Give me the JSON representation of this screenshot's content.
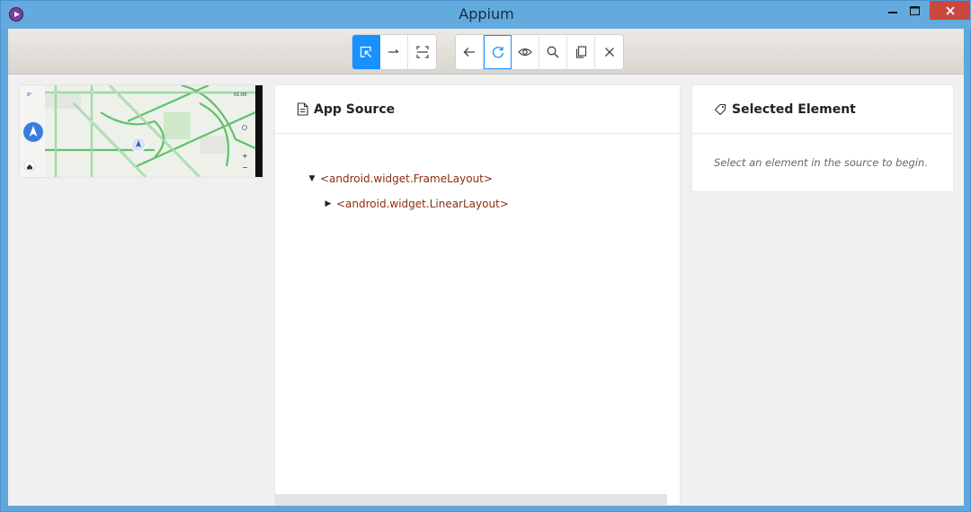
{
  "window": {
    "title": "Appium"
  },
  "toolbar": {
    "select_label": "Select Elements",
    "swipe_label": "Swipe By Coordinates",
    "tap_label": "Tap By Coordinates",
    "back_label": "Back",
    "refresh_label": "Refresh Source & Screenshot",
    "inspect_label": "Start Recording",
    "search_label": "Search for element",
    "copy_label": "Copy XML Source to Clipboard",
    "quit_label": "Quit Session & Close Inspector"
  },
  "source": {
    "title": "App Source",
    "nodes": [
      {
        "label": "<android.widget.FrameLayout>",
        "expanded": true
      },
      {
        "label": "<android.widget.LinearLayout>",
        "expanded": false
      }
    ]
  },
  "selected": {
    "title": "Selected Element",
    "hint": "Select an element in the source to begin."
  },
  "device": {
    "status_time": "01:00"
  },
  "colors": {
    "accent": "#1890ff",
    "titlebar": "#63aade",
    "close": "#c9483f",
    "tag_text": "#8a2d12"
  }
}
